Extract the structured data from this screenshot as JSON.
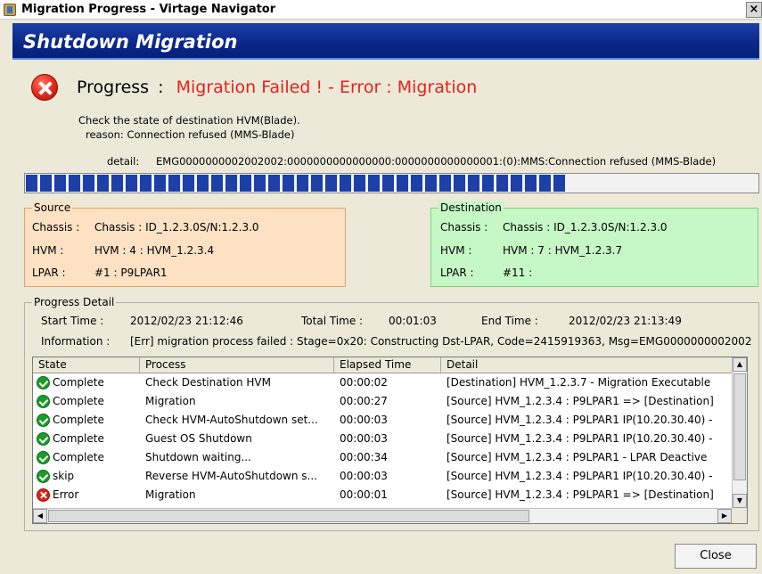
{
  "window": {
    "title": "Migration Progress - Virtage Navigator",
    "close_glyph": "×"
  },
  "header": {
    "title": "Shutdown Migration"
  },
  "status": {
    "label": "Progress",
    "separator": ":",
    "value": "Migration Failed ! - Error : Migration",
    "message_line1": "Check the state of destination HVM(Blade).",
    "message_line2": "reason: Connection refused (MMS-Blade)",
    "detail_label": "detail:",
    "detail_value": "EMG0000000002002002:0000000000000000:0000000000000001:(0):MMS:Connection refused (MMS-Blade)",
    "progress_fraction": 0.74,
    "colors": {
      "error": "#e8201a",
      "band": "#0a2788"
    }
  },
  "source": {
    "legend": "Source",
    "chassis_label": "Chassis :",
    "chassis_value": "Chassis : ID_1.2.3.0S/N:1.2.3.0",
    "hvm_label": "HVM :",
    "hvm_value": "HVM : 4 : HVM_1.2.3.4",
    "lpar_label": "LPAR :",
    "lpar_value": "#1 : P9LPAR1"
  },
  "destination": {
    "legend": "Destination",
    "chassis_label": "Chassis :",
    "chassis_value": "Chassis : ID_1.2.3.0S/N:1.2.3.0",
    "hvm_label": "HVM :",
    "hvm_value": "HVM : 7 : HVM_1.2.3.7",
    "lpar_label": "LPAR :",
    "lpar_value": "#11 :"
  },
  "progress_detail": {
    "legend": "Progress Detail",
    "start_label": "Start Time :",
    "start_value": "2012/02/23 21:12:46",
    "total_label": "Total Time :",
    "total_value": "00:01:03",
    "end_label": "End Time :",
    "end_value": "2012/02/23 21:13:49",
    "info_label": "Information :",
    "info_value": "[Err] migration process failed : Stage=0x20: Constructing Dst-LPAR, Code=2415919363, Msg=EMG0000000002002",
    "columns": [
      "State",
      "Process",
      "Elapsed Time",
      "Detail"
    ],
    "rows": [
      {
        "icon": "check-icon",
        "state": "Complete",
        "process": "Check Destination HVM",
        "elapsed": "00:00:02",
        "detail": "[Destination] HVM_1.2.3.7     - Migration Executable"
      },
      {
        "icon": "check-icon",
        "state": "Complete",
        "process": "Migration",
        "elapsed": "00:00:27",
        "detail": "[Source] HVM_1.2.3.4     : P9LPAR1 => [Destination]"
      },
      {
        "icon": "check-icon",
        "state": "Complete",
        "process": "Check HVM-AutoShutdown set...",
        "elapsed": "00:00:03",
        "detail": "[Source] HVM_1.2.3.4     : P9LPAR1 IP(10.20.30.40) -"
      },
      {
        "icon": "check-icon",
        "state": "Complete",
        "process": "Guest OS Shutdown",
        "elapsed": "00:00:03",
        "detail": "[Source] HVM_1.2.3.4     : P9LPAR1 IP(10.20.30.40) -"
      },
      {
        "icon": "check-icon",
        "state": "Complete",
        "process": "Shutdown waiting...",
        "elapsed": "00:00:34",
        "detail": "[Source] HVM_1.2.3.4     : P9LPAR1 - LPAR Deactive"
      },
      {
        "icon": "check-icon",
        "state": "skip",
        "process": "Reverse HVM-AutoShutdown s...",
        "elapsed": "00:00:03",
        "detail": "[Source] HVM_1.2.3.4     : P9LPAR1 IP(10.20.30.40) -"
      },
      {
        "icon": "error-icon",
        "state": "Error",
        "process": "Migration",
        "elapsed": "00:00:01",
        "detail": "[Source] HVM_1.2.3.4     : P9LPAR1 => [Destination]"
      }
    ]
  },
  "footer": {
    "close_label": "Close"
  }
}
